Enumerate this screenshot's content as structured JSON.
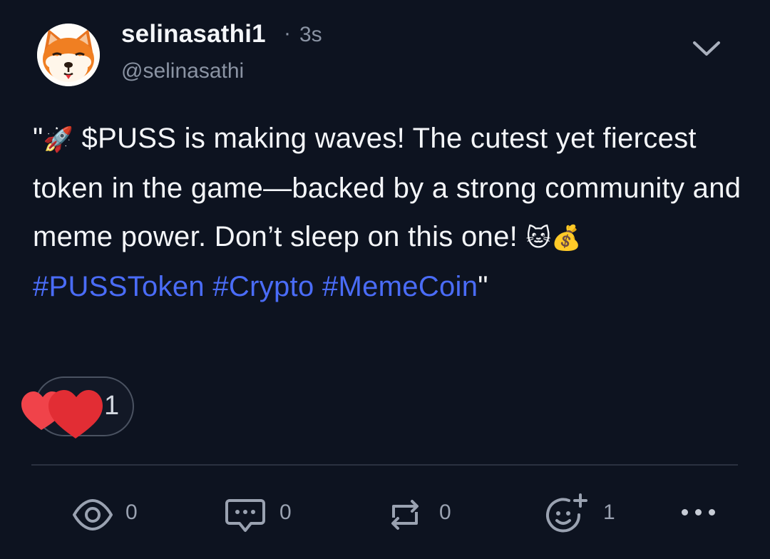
{
  "post": {
    "author_name": "selinasathi1",
    "separator": "·",
    "time": "3s",
    "handle": "@selinasathi",
    "avatar_icon": "shiba-inu-avatar",
    "text": {
      "quote_open": "\"",
      "emoji_rocket": "🚀",
      "line_main": " $PUSS is making waves! The cutest yet fiercest token in the game—backed by a strong community and meme power. Don’t sleep on this one! ",
      "emoji_cat": "🐱",
      "emoji_money": "💰",
      "hashtags": [
        "#PUSSToken",
        "#Crypto",
        "#MemeCoin"
      ],
      "quote_close": "\""
    },
    "reactions": {
      "icon": "hearts-icon",
      "count": "1"
    },
    "actions": {
      "views": "0",
      "comments": "0",
      "reposts": "0",
      "reacts": "1"
    }
  },
  "colors": {
    "background": "#0d1320",
    "hashtag": "#4a6cf7",
    "heart": "#e8333a",
    "muted": "#8a93a3"
  }
}
